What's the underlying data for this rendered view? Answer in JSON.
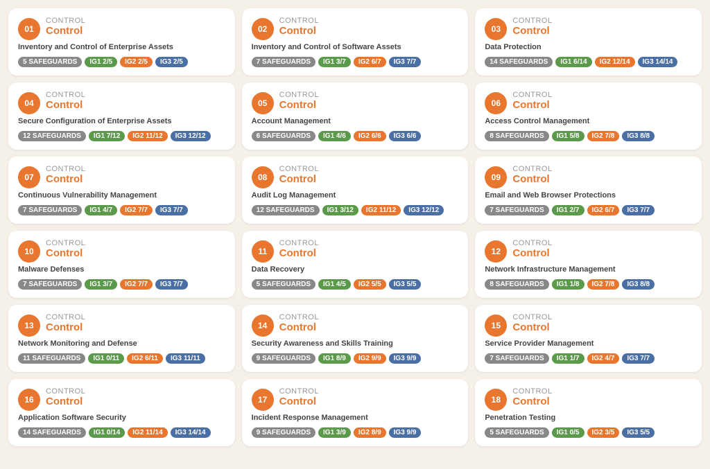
{
  "cards": [
    {
      "number": "01",
      "label": "Control",
      "title": "Inventory and Control of Enterprise Assets",
      "safeguards": "5 SAFEGUARDS",
      "ig1": "IG1 2/5",
      "ig2": "IG2 2/5",
      "ig3": "IG3 2/5"
    },
    {
      "number": "02",
      "label": "Control",
      "title": "Inventory and Control of Software Assets",
      "safeguards": "7 SAFEGUARDS",
      "ig1": "IG1 3/7",
      "ig2": "IG2 6/7",
      "ig3": "IG3 7/7"
    },
    {
      "number": "03",
      "label": "Control",
      "title": "Data Protection",
      "safeguards": "14 SAFEGUARDS",
      "ig1": "IG1 6/14",
      "ig2": "IG2 12/14",
      "ig3": "IG3 14/14"
    },
    {
      "number": "04",
      "label": "Control",
      "title": "Secure Configuration of Enterprise Assets",
      "safeguards": "12 SAFEGUARDS",
      "ig1": "IG1 7/12",
      "ig2": "IG2 11/12",
      "ig3": "IG3 12/12"
    },
    {
      "number": "05",
      "label": "Control",
      "title": "Account Management",
      "safeguards": "6 SAFEGUARDS",
      "ig1": "IG1 4/6",
      "ig2": "IG2 6/6",
      "ig3": "IG3 6/6"
    },
    {
      "number": "06",
      "label": "Control",
      "title": "Access Control Management",
      "safeguards": "8 SAFEGUARDS",
      "ig1": "IG1 5/8",
      "ig2": "IG2 7/8",
      "ig3": "IG3 8/8"
    },
    {
      "number": "07",
      "label": "Control",
      "title": "Continuous Vulnerability Management",
      "safeguards": "7 SAFEGUARDS",
      "ig1": "IG1 4/7",
      "ig2": "IG2 7/7",
      "ig3": "IG3 7/7"
    },
    {
      "number": "08",
      "label": "Control",
      "title": "Audit Log Management",
      "safeguards": "12 SAFEGUARDS",
      "ig1": "IG1 3/12",
      "ig2": "IG2 11/12",
      "ig3": "IG3 12/12"
    },
    {
      "number": "09",
      "label": "Control",
      "title": "Email and Web Browser Protections",
      "safeguards": "7 SAFEGUARDS",
      "ig1": "IG1 2/7",
      "ig2": "IG2 6/7",
      "ig3": "IG3 7/7"
    },
    {
      "number": "10",
      "label": "Control",
      "title": "Malware Defenses",
      "safeguards": "7 SAFEGUARDS",
      "ig1": "IG1 3/7",
      "ig2": "IG2 7/7",
      "ig3": "IG3 7/7"
    },
    {
      "number": "11",
      "label": "Control",
      "title": "Data Recovery",
      "safeguards": "5 SAFEGUARDS",
      "ig1": "IG1 4/5",
      "ig2": "IG2 5/5",
      "ig3": "IG3 5/5"
    },
    {
      "number": "12",
      "label": "Control",
      "title": "Network Infrastructure Management",
      "safeguards": "8 SAFEGUARDS",
      "ig1": "IG1 1/8",
      "ig2": "IG2 7/8",
      "ig3": "IG3 8/8"
    },
    {
      "number": "13",
      "label": "Control",
      "title": "Network Monitoring and Defense",
      "safeguards": "11 SAFEGUARDS",
      "ig1": "IG1 0/11",
      "ig2": "IG2 6/11",
      "ig3": "IG3 11/11"
    },
    {
      "number": "14",
      "label": "Control",
      "title": "Security Awareness and Skills Training",
      "safeguards": "9 SAFEGUARDS",
      "ig1": "IG1 8/9",
      "ig2": "IG2 9/9",
      "ig3": "IG3 9/9"
    },
    {
      "number": "15",
      "label": "Control",
      "title": "Service Provider Management",
      "safeguards": "7 SAFEGUARDS",
      "ig1": "IG1 1/7",
      "ig2": "IG2 4/7",
      "ig3": "IG3 7/7"
    },
    {
      "number": "16",
      "label": "Control",
      "title": "Application Software Security",
      "safeguards": "14 SAFEGUARDS",
      "ig1": "IG1 0/14",
      "ig2": "IG2 11/14",
      "ig3": "IG3 14/14"
    },
    {
      "number": "17",
      "label": "Control",
      "title": "Incident Response Management",
      "safeguards": "9 SAFEGUARDS",
      "ig1": "IG1 3/9",
      "ig2": "IG2 8/9",
      "ig3": "IG3 9/9"
    },
    {
      "number": "18",
      "label": "Control",
      "title": "Penetration Testing",
      "safeguards": "5 SAFEGUARDS",
      "ig1": "IG1 0/5",
      "ig2": "IG2 3/5",
      "ig3": "IG3 5/5"
    }
  ]
}
